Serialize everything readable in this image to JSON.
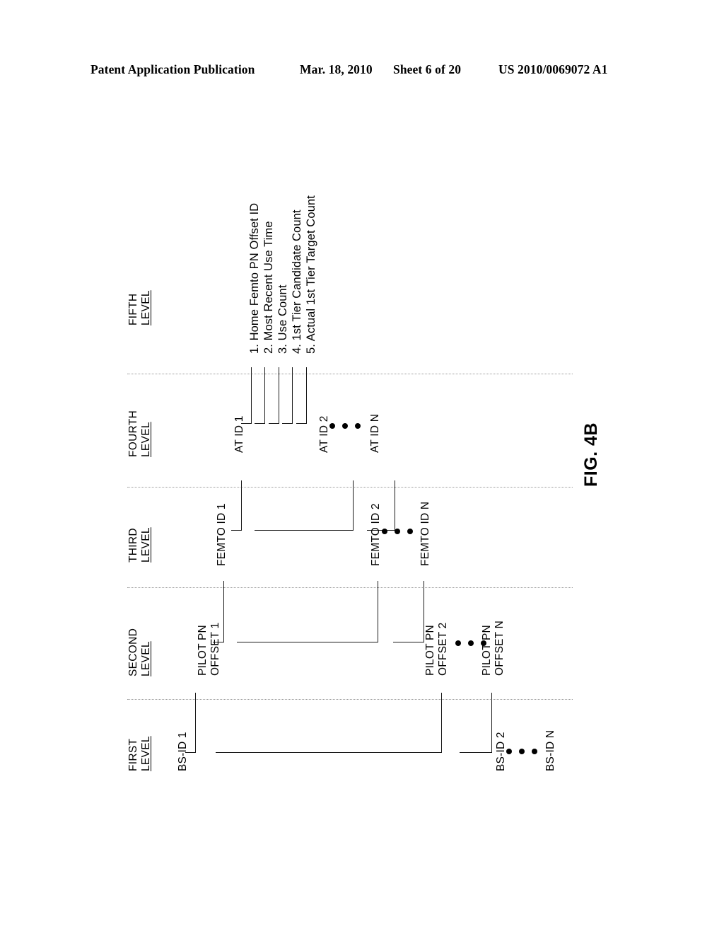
{
  "header": {
    "publication": "Patent Application Publication",
    "date": "Mar. 18, 2010",
    "sheet": "Sheet 6 of 20",
    "patent_number": "US 2010/0069072 A1"
  },
  "figure": {
    "caption": "FIG. 4B",
    "levels": [
      {
        "key": "first",
        "line1": "FIRST",
        "line2": "LEVEL"
      },
      {
        "key": "second",
        "line1": "SECOND",
        "line2": "LEVEL"
      },
      {
        "key": "third",
        "line1": "THIRD",
        "line2": "LEVEL"
      },
      {
        "key": "fourth",
        "line1": "FOURTH",
        "line2": "LEVEL"
      },
      {
        "key": "fifth",
        "line1": "FIFTH",
        "line2": "LEVEL"
      }
    ],
    "first_level_nodes": [
      {
        "label": "BS-ID 1"
      },
      {
        "label": "BS-ID 2"
      },
      {
        "label": "BS-ID N"
      }
    ],
    "second_level_nodes": [
      {
        "line1": "PILOT PN",
        "line2": "OFFSET 1"
      },
      {
        "line1": "PILOT PN",
        "line2": "OFFSET 2"
      },
      {
        "line1": "PILOT PN",
        "line2": "OFFSET N"
      }
    ],
    "third_level_nodes": [
      {
        "label": "FEMTO ID 1"
      },
      {
        "label": "FEMTO ID 2"
      },
      {
        "label": "FEMTO ID N"
      }
    ],
    "fourth_level_nodes": [
      {
        "label": "AT ID 1"
      },
      {
        "label": "AT ID 2"
      },
      {
        "label": "AT ID N"
      }
    ],
    "fifth_level_attributes": [
      "1.  Home Femto PN Offset ID",
      "2.  Most Recent Use Time",
      "3.  Use Count",
      "4.  1st Tier Candidate Count",
      "5.  Actual 1st Tier Target Count"
    ],
    "ellipsis": "• • •",
    "colors": {
      "ink": "#000000",
      "line": "#1a1a1a",
      "separator": "#9a9a9a",
      "background": "#ffffff"
    }
  }
}
